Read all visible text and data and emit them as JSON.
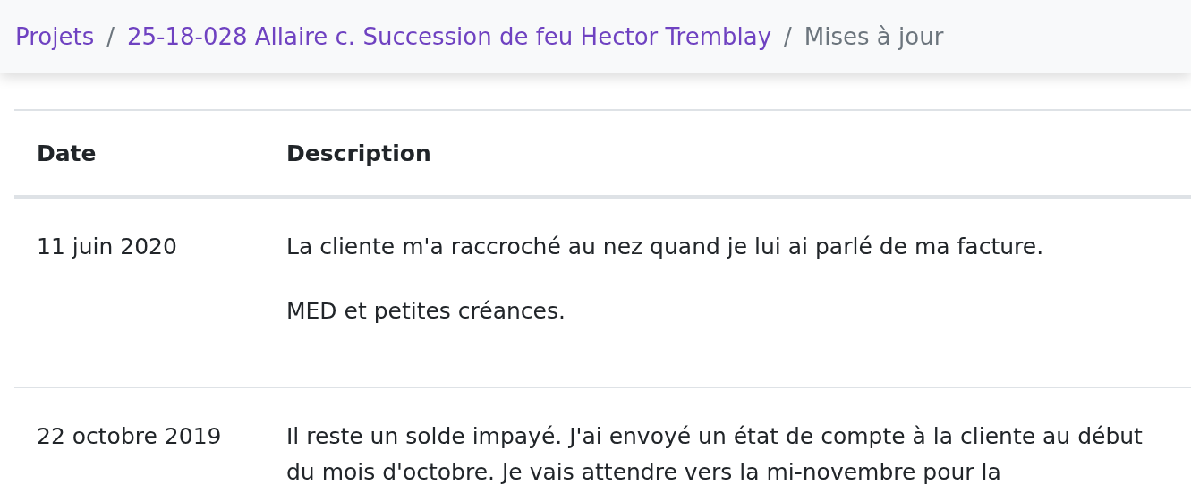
{
  "breadcrumb": [
    {
      "kind": "link",
      "text": "Projets"
    },
    {
      "kind": "separator",
      "text": "/"
    },
    {
      "kind": "link",
      "text": "25-18-028 Allaire c. Succession de feu Hector Tremblay"
    },
    {
      "kind": "separator",
      "text": "/"
    },
    {
      "kind": "current",
      "text": "Mises à jour"
    }
  ],
  "table": {
    "columns": [
      "Date",
      "Description"
    ],
    "rows": [
      {
        "date": "11 juin 2020",
        "paragraphs": [
          "La cliente m'a raccroché au nez quand je lui ai parlé de ma facture.",
          "MED et petites créances."
        ]
      },
      {
        "date": "22 octobre 2019",
        "paragraphs": [
          "Il reste un solde impayé. J'ai envoyé un état de compte à la cliente au début du mois d'octobre. Je vais attendre vers la mi-novembre pour la"
        ]
      }
    ]
  }
}
